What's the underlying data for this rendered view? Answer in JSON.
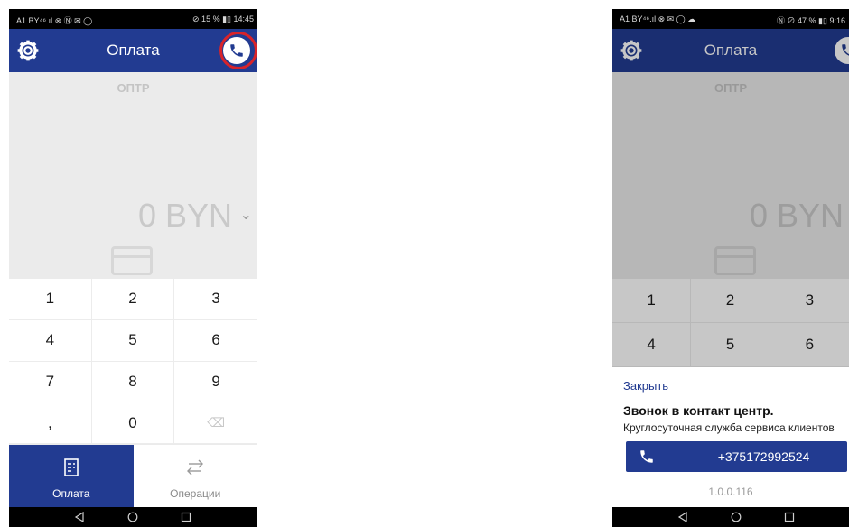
{
  "left": {
    "status": {
      "carrier": "A1 BY⁴⁶.ıl ⊗ Ⓝ ✉ ◯",
      "right": "⊘ 15 % ▮▯ 14:45"
    },
    "header": {
      "title": "Оплата"
    },
    "merchant": "ОПТР",
    "amount": "0 BYN",
    "keypad": [
      "1",
      "2",
      "3",
      "4",
      "5",
      "6",
      "7",
      "8",
      "9",
      ",",
      "0",
      "⌫"
    ],
    "nav": {
      "pay": "Оплата",
      "ops": "Операции"
    }
  },
  "right": {
    "status": {
      "carrier": "A1 BY⁴⁶.ıl ⊗ ✉ ◯ ☁",
      "right": "Ⓝ ⊘ 47 % ▮▯ 9:16"
    },
    "header": {
      "title": "Оплата"
    },
    "merchant": "ОПТР",
    "amount": "0 BYN",
    "keypad": [
      "1",
      "2",
      "3",
      "4",
      "5",
      "6"
    ],
    "sheet": {
      "close": "Закрыть",
      "heading": "Звонок в контакт центр.",
      "subtitle": "Круглосуточная служба сервиса клиентов",
      "phone": "+375172992524",
      "version": "1.0.0.116"
    }
  }
}
